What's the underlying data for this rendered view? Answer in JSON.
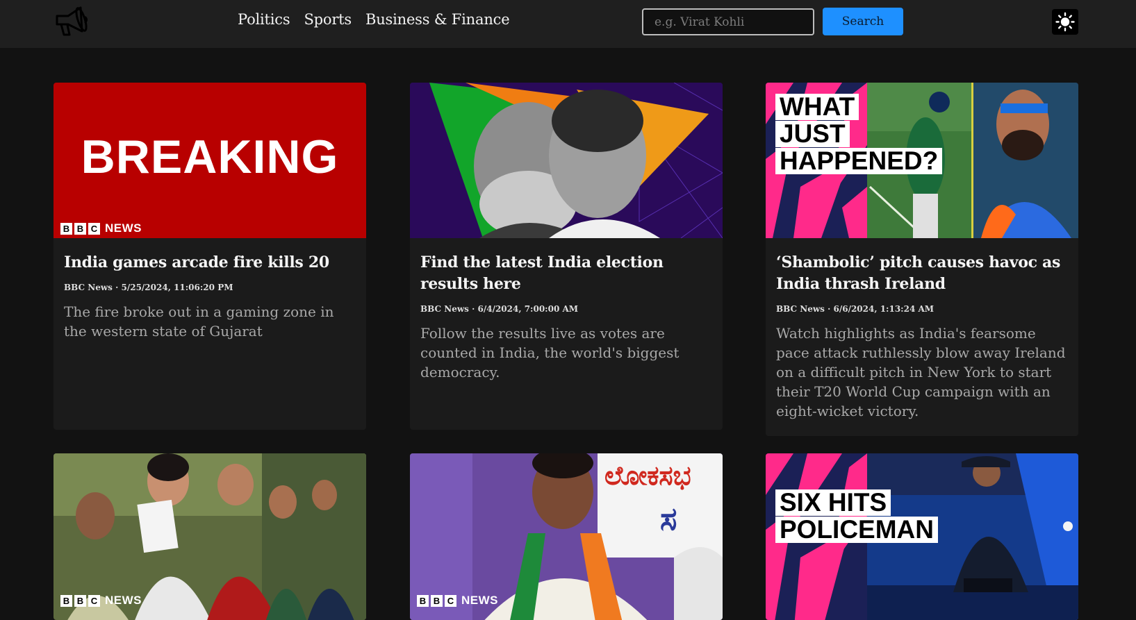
{
  "nav": {
    "links": [
      "Politics",
      "Sports",
      "Business & Finance"
    ],
    "search_placeholder": "e.g. Virat Kohli",
    "search_label": "Search"
  },
  "articles": [
    {
      "title": "India games arcade fire kills 20",
      "source": "BBC News",
      "date": "5/25/2024, 11:06:20 PM",
      "description": "The fire broke out in a gaming zone in the western state of Gujarat",
      "image_text": "BREAKING",
      "image_logo": "NEWS"
    },
    {
      "title": "Find the latest India election results here",
      "source": "BBC News",
      "date": "6/4/2024, 7:00:00 AM",
      "description": "Follow the results live as votes are counted in India, the world's biggest democracy."
    },
    {
      "title": "‘Shambolic’ pitch causes havoc as India thrash Ireland",
      "source": "BBC News",
      "date": "6/6/2024, 1:13:24 AM",
      "description": "Watch highlights as India's fearsome pace attack ruthlessly blow away Ireland on a difficult pitch in New York to start their T20 World Cup campaign with an eight-wicket victory.",
      "image_text": [
        "WHAT",
        "JUST",
        "HAPPENED?"
      ]
    },
    {
      "image_logo": "NEWS"
    },
    {
      "image_logo": "NEWS"
    },
    {
      "image_text": [
        "SIX HITS",
        "POLICEMAN"
      ]
    }
  ],
  "colors": {
    "page_bg": "#121212",
    "navbar_bg": "#1f1f1f",
    "card_bg": "#1b1b1b",
    "accent": "#1e90ff",
    "breaking_red": "#b80000"
  },
  "icons": {
    "logo": "megaphone-icon",
    "theme": "sun-icon"
  }
}
